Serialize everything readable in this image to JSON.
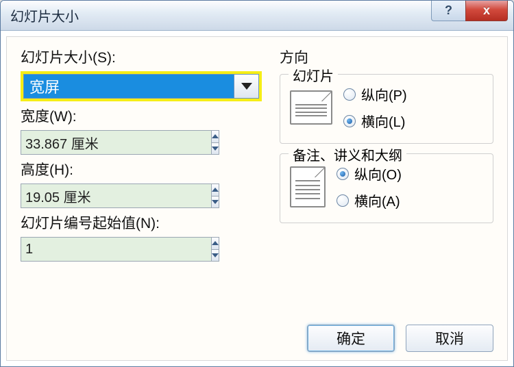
{
  "title": "幻灯片大小",
  "left": {
    "size_label": "幻灯片大小(S):",
    "size_value": "宽屏",
    "width_label": "宽度(W):",
    "width_value": "33.867 厘米",
    "height_label": "高度(H):",
    "height_value": "19.05 厘米",
    "start_label": "幻灯片编号起始值(N):",
    "start_value": "1"
  },
  "right": {
    "group_title": "方向",
    "slides": {
      "legend": "幻灯片",
      "portrait": "纵向(P)",
      "landscape": "横向(L)",
      "selected": "landscape"
    },
    "notes": {
      "legend": "备注、讲义和大纲",
      "portrait": "纵向(O)",
      "landscape": "横向(A)",
      "selected": "portrait"
    }
  },
  "buttons": {
    "ok": "确定",
    "cancel": "取消"
  },
  "titlebar": {
    "help": "?",
    "close": "x"
  }
}
